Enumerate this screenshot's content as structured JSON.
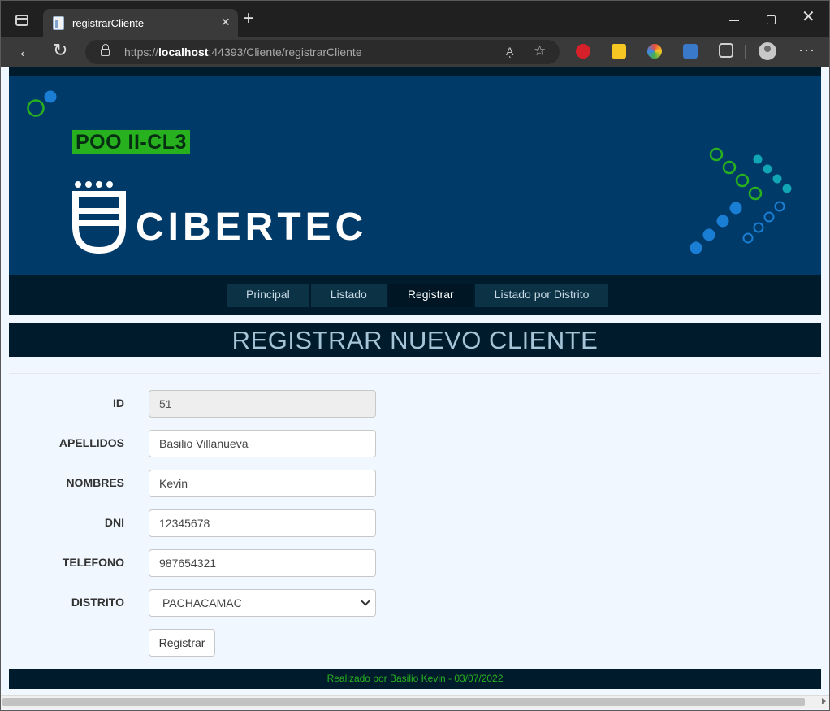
{
  "browser": {
    "tab_title": "registrarCliente",
    "url_scheme": "https://",
    "url_host": "localhost",
    "url_rest": ":44393/Cliente/registrarCliente",
    "read_aloud": "Aͅ"
  },
  "header": {
    "course_badge": "POO II-CL3",
    "brand": "CIBERTEC",
    "colors": {
      "banner": "#003a68",
      "dark": "#001c2c",
      "accent_green": "#27b11f"
    }
  },
  "nav": {
    "items": [
      {
        "label": "Principal"
      },
      {
        "label": "Listado"
      },
      {
        "label": "Registrar"
      },
      {
        "label": "Listado por Distrito"
      }
    ]
  },
  "page": {
    "title": "REGISTRAR NUEVO CLIENTE"
  },
  "form": {
    "id_label": "ID",
    "id_value": "51",
    "apellidos_label": "APELLIDOS",
    "apellidos_value": "Basilio Villanueva",
    "nombres_label": "NOMBRES",
    "nombres_value": "Kevin",
    "dni_label": "DNI",
    "dni_value": "12345678",
    "telefono_label": "TELEFONO",
    "telefono_value": "987654321",
    "distrito_label": "DISTRITO",
    "distrito_value": "PACHACAMAC",
    "submit_label": "Registrar"
  },
  "footer": {
    "text": "Realizado por Basilio Kevin - 03/07/2022"
  }
}
